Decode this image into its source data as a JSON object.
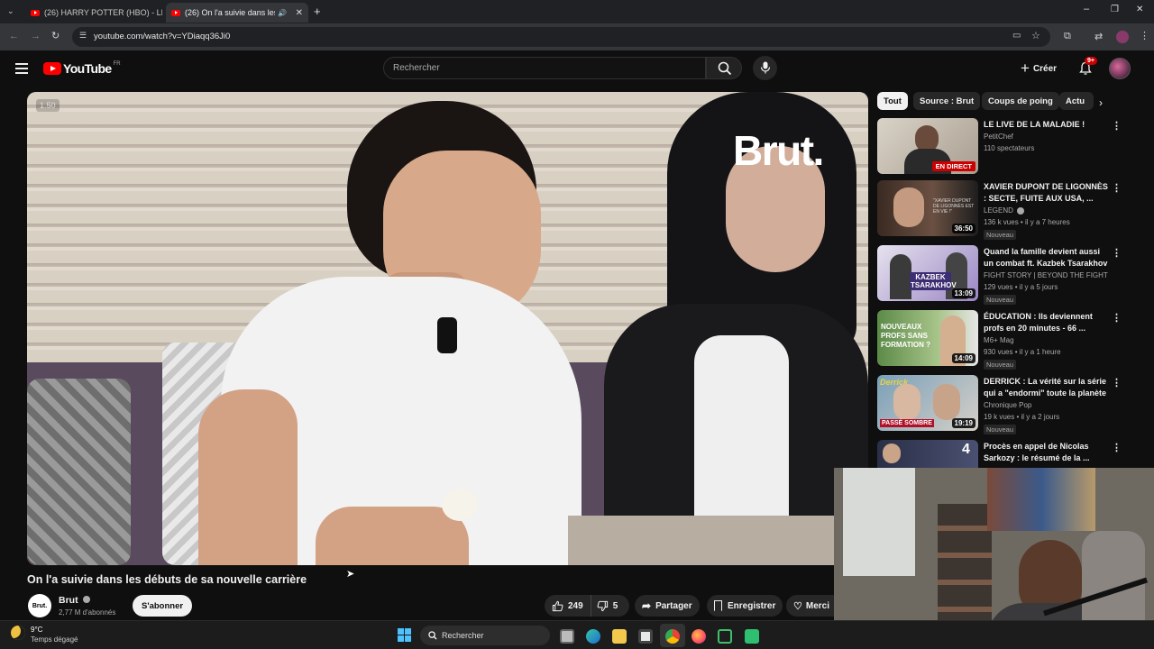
{
  "browser": {
    "tabs": [
      {
        "label": "(26) HARRY POTTER (HBO) - LE"
      },
      {
        "label": "(26) On l'a suivie dans les d"
      }
    ],
    "url": "youtube.com/watch?v=YDiaqq36Ji0"
  },
  "header": {
    "logo_text": "YouTube",
    "region": "FR",
    "search_placeholder": "Rechercher",
    "create_label": "Créer",
    "notifications_badge": "9+"
  },
  "video": {
    "watermark": "Brut.",
    "speed_badge": "1.50",
    "title": "On l'a suivie dans les débuts de sa nouvelle carrière"
  },
  "channel": {
    "avatar_text": "Brut.",
    "name": "Brut",
    "subscribers": "2,77 M d'abonnés",
    "subscribe_label": "S'abonner"
  },
  "actions": {
    "likes": "249",
    "dislikes": "5",
    "share": "Partager",
    "save": "Enregistrer",
    "thanks": "Merci"
  },
  "chips": [
    "Tout",
    "Source : Brut",
    "Coups de poing",
    "Actu"
  ],
  "recommendations": [
    {
      "title": "LE LIVE DE LA MALADIE !",
      "channel": "PetitChef",
      "meta": "110 spectateurs",
      "badge": "",
      "duration": "",
      "live": "EN DIRECT"
    },
    {
      "title": "XAVIER DUPONT DE LIGONNÈS : SECTE, FUITE AUX USA, ...",
      "channel": "LEGEND",
      "meta": "136 k vues • il y a 7 heures",
      "badge": "Nouveau",
      "duration": "36:50",
      "live": ""
    },
    {
      "title": "Quand la famille devient aussi un combat ft. Kazbek Tsarakhov",
      "channel": "FIGHT STORY  |  BEYOND THE FIGHT",
      "meta": "129 vues • il y a 5 jours",
      "badge": "Nouveau",
      "duration": "13:09",
      "live": ""
    },
    {
      "title": "ÉDUCATION : Ils deviennent profs en 20 minutes - 66 ...",
      "channel": "M6+ Mag",
      "meta": "930 vues • il y a 1 heure",
      "badge": "Nouveau",
      "duration": "14:09",
      "live": ""
    },
    {
      "title": "DERRICK : La vérité sur la série qui a \"endormi\" toute la planète",
      "channel": "Chronique Pop",
      "meta": "19 k vues • il y a 2 jours",
      "badge": "Nouveau",
      "duration": "19:19",
      "live": ""
    },
    {
      "title": "Procès en appel de Nicolas Sarkozy : le résumé de la ...",
      "channel": "",
      "meta": "",
      "badge": "",
      "duration": "",
      "live": ""
    }
  ],
  "thumb_texts": {
    "t3": "KAZBEK TSARAKHOV",
    "t4": "NOUVEAUX PROFS SANS FORMATION ?",
    "t5a": "Derrick",
    "t5b": "PASSÉ SOMBRE",
    "t6": "4"
  },
  "taskbar": {
    "temp": "9°C",
    "weather": "Temps dégagé",
    "search": "Rechercher"
  },
  "colors": {
    "accent_red": "#ff0000",
    "bg": "#0f0f0f",
    "chip_active": "#f1f1f1"
  }
}
